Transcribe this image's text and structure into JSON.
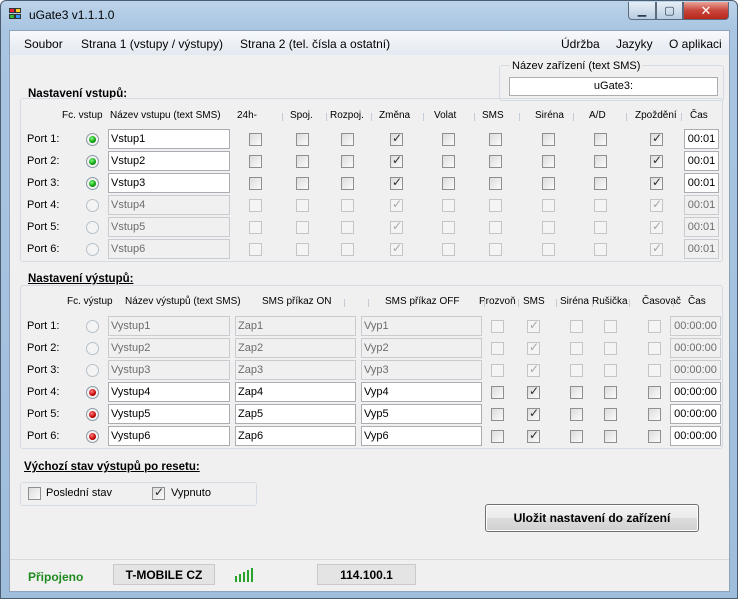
{
  "window": {
    "title": "uGate3 v1.1.1.0"
  },
  "menu": {
    "items": [
      "Soubor",
      "Strana 1 (vstupy / výstupy)",
      "Strana 2 (tel. čísla a ostatní)",
      "Údržba",
      "Jazyky",
      "O aplikaci"
    ]
  },
  "device_name": {
    "legend": "Název zařízení (text SMS)",
    "value": "uGate3:"
  },
  "inputs": {
    "title": "Nastavení vstupů:",
    "headers": [
      "Fc. vstup",
      "Název vstupu (text SMS)",
      "24h-",
      "Spoj.",
      "Rozpoj.",
      "Změna",
      "Volat",
      "SMS",
      "Siréna",
      "A/D",
      "Zpoždění",
      "Čas"
    ],
    "rows": [
      {
        "label": "Port 1:",
        "active": true,
        "name": "Vstup1",
        "checks": [
          false,
          false,
          false,
          true,
          false,
          false,
          false,
          false,
          true
        ],
        "time": "00:01"
      },
      {
        "label": "Port 2:",
        "active": true,
        "name": "Vstup2",
        "checks": [
          false,
          false,
          false,
          true,
          false,
          false,
          false,
          false,
          true
        ],
        "time": "00:01"
      },
      {
        "label": "Port 3:",
        "active": true,
        "name": "Vstup3",
        "checks": [
          false,
          false,
          false,
          true,
          false,
          false,
          false,
          false,
          true
        ],
        "time": "00:01"
      },
      {
        "label": "Port 4:",
        "active": false,
        "name": "Vstup4",
        "checks": [
          false,
          false,
          false,
          true,
          false,
          false,
          false,
          false,
          true
        ],
        "time": "00:01"
      },
      {
        "label": "Port 5:",
        "active": false,
        "name": "Vstup5",
        "checks": [
          false,
          false,
          false,
          true,
          false,
          false,
          false,
          false,
          true
        ],
        "time": "00:01"
      },
      {
        "label": "Port 6:",
        "active": false,
        "name": "Vstup6",
        "checks": [
          false,
          false,
          false,
          true,
          false,
          false,
          false,
          false,
          true
        ],
        "time": "00:01"
      }
    ]
  },
  "outputs": {
    "title": "Nastavení výstupů:",
    "headers": [
      "Fc. výstup",
      "Název výstupů (text SMS)",
      "SMS příkaz ON",
      "SMS příkaz OFF",
      "Prozvoň",
      "SMS",
      "Siréna",
      "Rušička",
      "Časovač",
      "Čas"
    ],
    "rows": [
      {
        "label": "Port 1:",
        "active": false,
        "name": "Vystup1",
        "on": "Zap1",
        "off": "Vyp1",
        "checks": [
          false,
          true,
          false,
          false,
          false
        ],
        "time": "00:00:00"
      },
      {
        "label": "Port 2:",
        "active": false,
        "name": "Vystup2",
        "on": "Zap2",
        "off": "Vyp2",
        "checks": [
          false,
          true,
          false,
          false,
          false
        ],
        "time": "00:00:00"
      },
      {
        "label": "Port 3:",
        "active": false,
        "name": "Vystup3",
        "on": "Zap3",
        "off": "Vyp3",
        "checks": [
          false,
          true,
          false,
          false,
          false
        ],
        "time": "00:00:00"
      },
      {
        "label": "Port 4:",
        "active": true,
        "name": "Vystup4",
        "on": "Zap4",
        "off": "Vyp4",
        "checks": [
          false,
          true,
          false,
          false,
          false
        ],
        "time": "00:00:00"
      },
      {
        "label": "Port 5:",
        "active": true,
        "name": "Vystup5",
        "on": "Zap5",
        "off": "Vyp5",
        "checks": [
          false,
          true,
          false,
          false,
          false
        ],
        "time": "00:00:00"
      },
      {
        "label": "Port 6:",
        "active": true,
        "name": "Vystup6",
        "on": "Zap6",
        "off": "Vyp6",
        "checks": [
          false,
          true,
          false,
          false,
          false
        ],
        "time": "00:00:00"
      }
    ]
  },
  "reset_state": {
    "title": "Výchozí stav výstupů po resetu:",
    "options": [
      {
        "label": "Poslední stav",
        "checked": false
      },
      {
        "label": "Vypnuto",
        "checked": true
      }
    ]
  },
  "save_button": {
    "label": "Uložit nastavení do zařízení"
  },
  "status": {
    "connection": "Připojeno",
    "operator": "T-MOBILE CZ",
    "signal_level": 5,
    "signal_max": 5,
    "credit": "114.100.1"
  },
  "colors": {
    "active_input": "#0a9b0a",
    "active_output": "#c00000",
    "connected": "#1f8a1f"
  }
}
